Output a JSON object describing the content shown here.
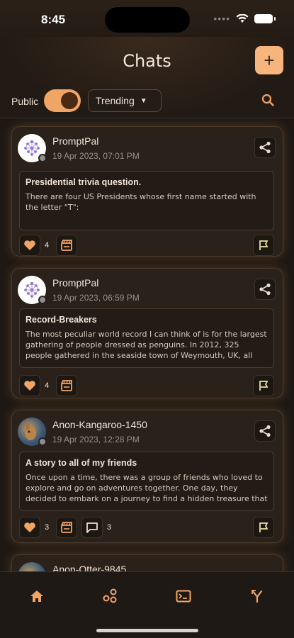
{
  "status_bar": {
    "time": "8:45"
  },
  "header": {
    "title": "Chats",
    "add_label": "+",
    "public_label": "Public",
    "public_on": true,
    "filter_selected": "Trending"
  },
  "colors": {
    "accent": "#f5b57c",
    "background": "#1e1814",
    "card": "#2a211b"
  },
  "chats": [
    {
      "author": "PromptPal",
      "timestamp": "19 Apr 2023, 07:01 PM",
      "title": "Presidential trivia question.",
      "body": "There are four US Presidents whose first name started with the letter \"T\":",
      "likes": "4",
      "avatar": "promptpal-logo-icon"
    },
    {
      "author": "PromptPal",
      "timestamp": "19 Apr 2023, 06:59 PM",
      "title": "Record-Breakers",
      "body": "The most peculiar world record I can think of is for the largest gathering of people dressed as penguins. In 2012, 325 people gathered in the seaside town of Weymouth, UK, all dressed i...",
      "likes": "4",
      "avatar": "promptpal-logo-icon"
    },
    {
      "author": "Anon-Kangaroo-1450",
      "timestamp": "19 Apr 2023, 12:28 PM",
      "title": "A story to all of my friends",
      "body": "Once upon a time, there was a group of friends who loved to explore and go on adventures together. One day, they decided to embark on a journey to find a hidden treasure that was sai...",
      "likes": "3",
      "comments": "3",
      "avatar": "kangaroo-avatar-icon"
    },
    {
      "author": "Anon-Otter-9845",
      "avatar": "otter-avatar-icon"
    }
  ],
  "tabs": [
    "home-icon",
    "community-icon",
    "terminal-icon",
    "branch-icon"
  ]
}
